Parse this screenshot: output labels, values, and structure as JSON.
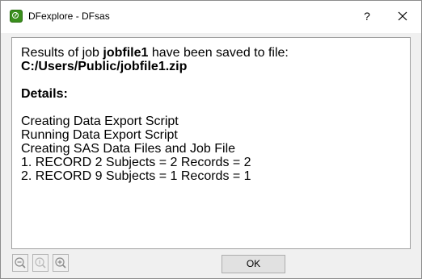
{
  "window": {
    "title": "DFexplore - DFsas",
    "help_label": "?"
  },
  "content": {
    "result_prefix": "Results of job ",
    "job_name": "jobfile1",
    "result_suffix": " have been saved to file:",
    "file_path": "C:/Users/Public/jobfile1.zip",
    "details_heading": "Details:",
    "details": [
      "Creating Data Export Script",
      "Running Data Export Script",
      "Creating SAS Data Files and Job File",
      "1. RECORD 2 Subjects = 2 Records = 2",
      "2. RECORD 9 Subjects = 1 Records = 1"
    ]
  },
  "footer": {
    "ok_label": "OK",
    "icons": [
      "zoom-out-icon",
      "zoom-reset-icon",
      "zoom-in-icon"
    ]
  },
  "colors": {
    "app_icon": "#3a8f1c",
    "titlebar_bg": "#ffffff",
    "dialog_bg": "#f0f0f0",
    "disabled_icon": "#9a9a9a"
  }
}
